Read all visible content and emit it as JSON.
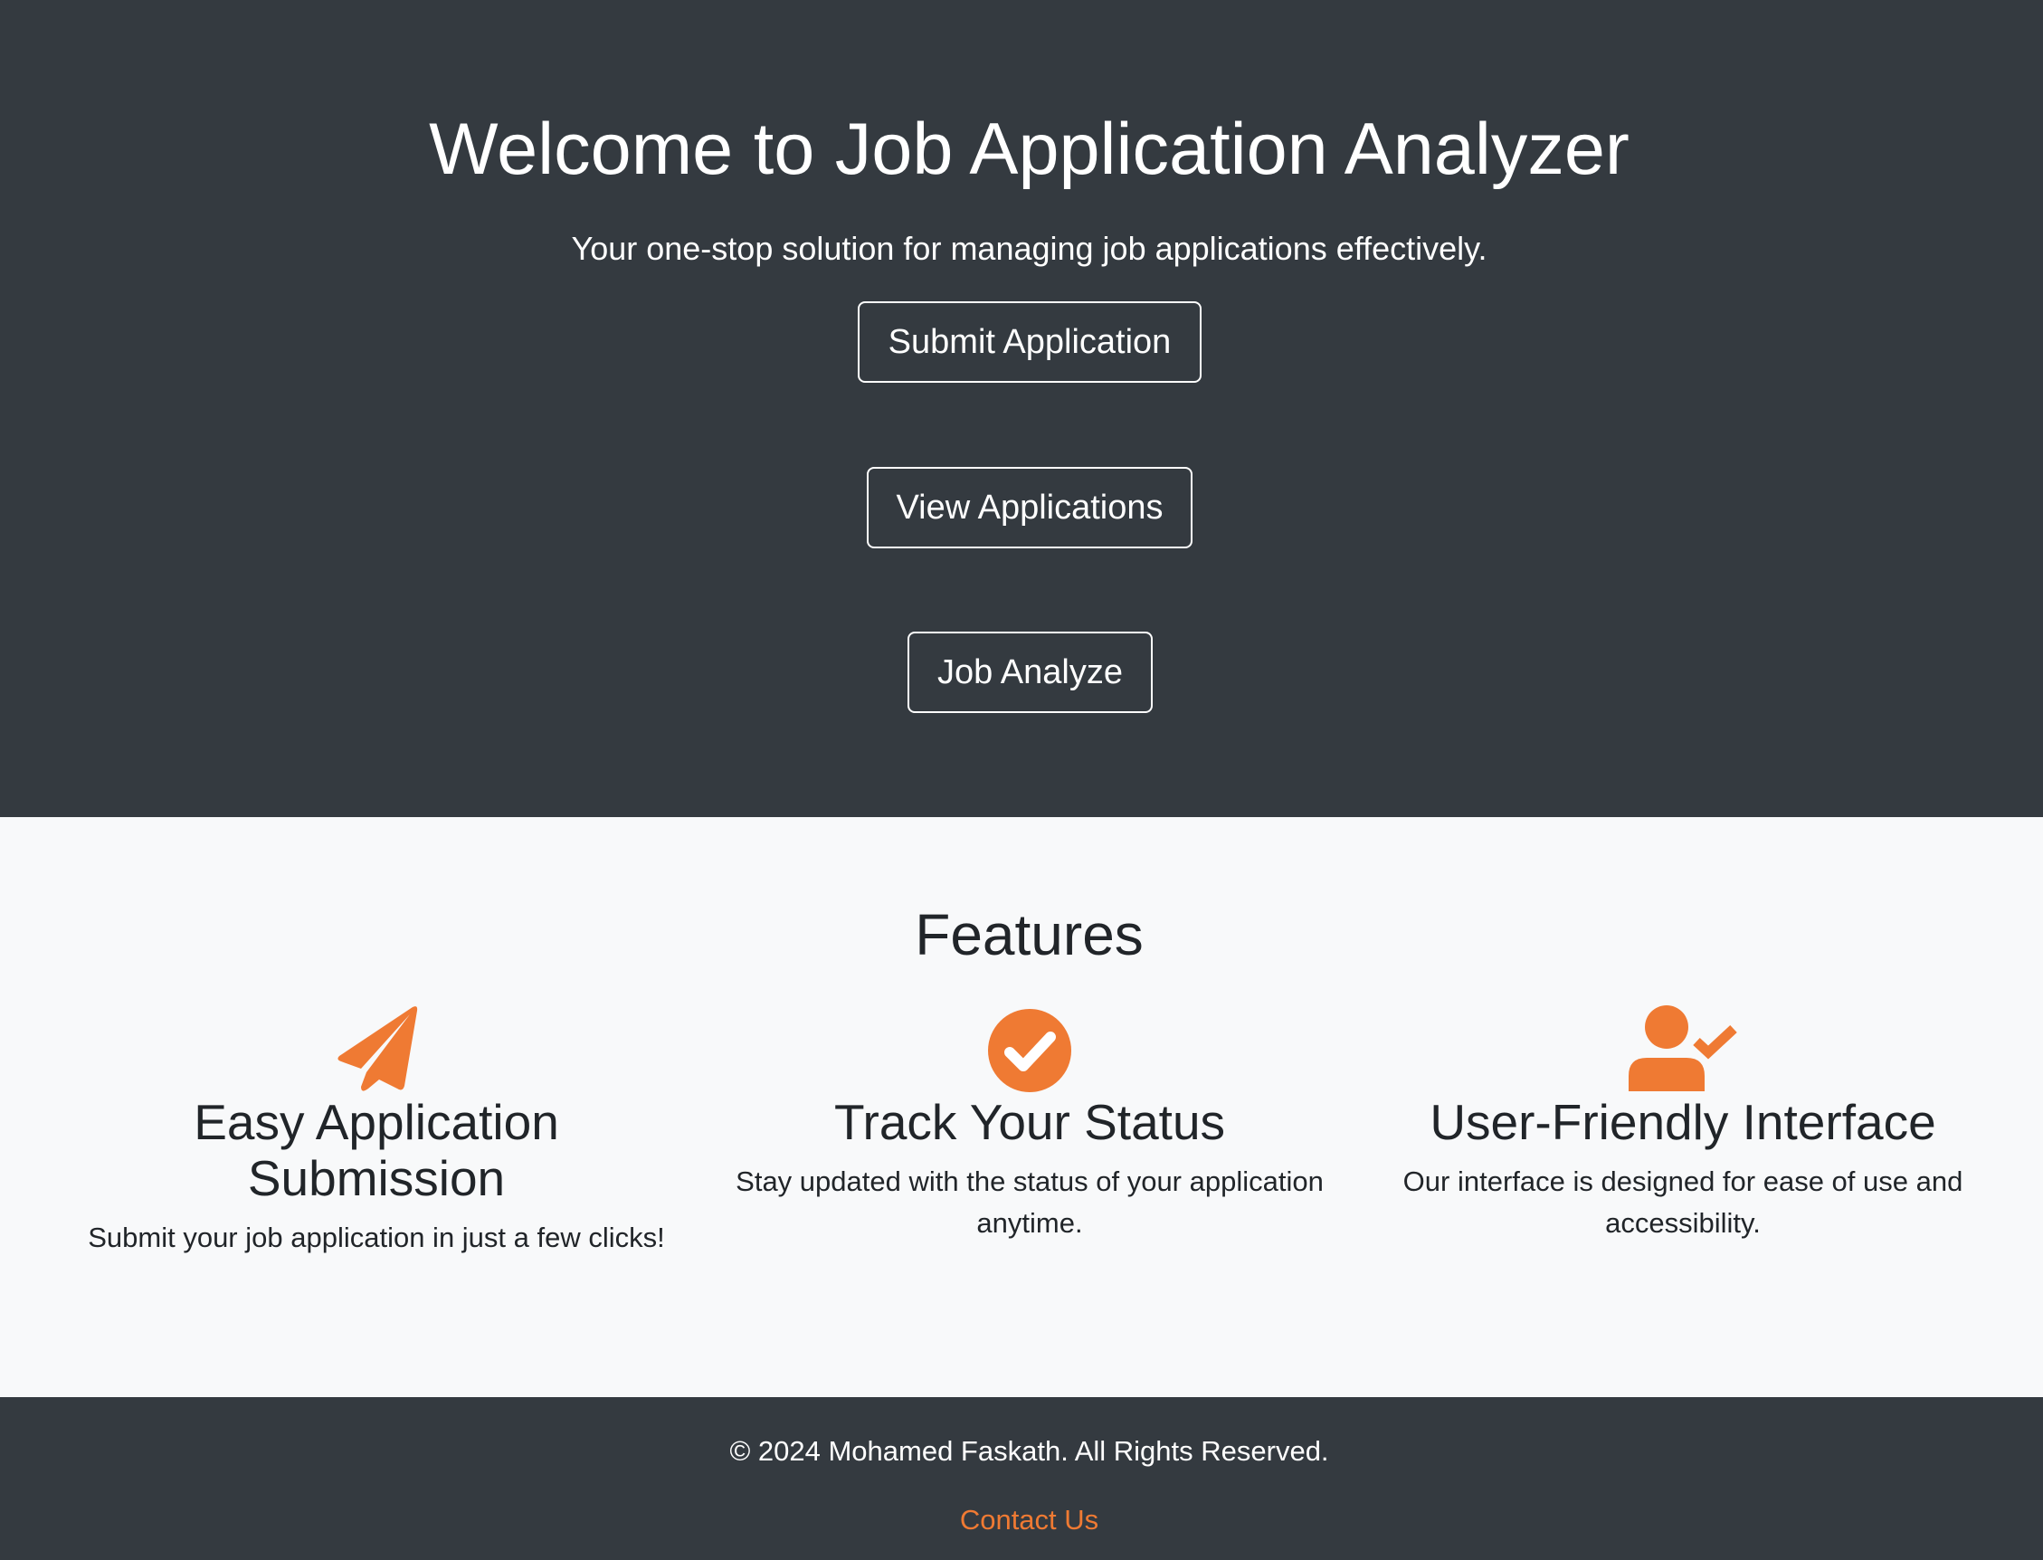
{
  "colors": {
    "dark_bg": "#343a40",
    "light_bg": "#f8f9fa",
    "accent": "#ef7a33",
    "text_light": "#ffffff",
    "text_dark": "#212529"
  },
  "hero": {
    "title": "Welcome to Job Application Analyzer",
    "subtitle": "Your one-stop solution for managing job applications effectively.",
    "buttons": [
      {
        "label": "Submit Application"
      },
      {
        "label": "View Applications"
      },
      {
        "label": "Job Analyze"
      }
    ]
  },
  "features": {
    "title": "Features",
    "items": [
      {
        "icon": "paper-plane-icon",
        "title": "Easy Application Submission",
        "text": "Submit your job application in just a few clicks!"
      },
      {
        "icon": "check-circle-icon",
        "title": "Track Your Status",
        "text": "Stay updated with the status of your application anytime."
      },
      {
        "icon": "user-check-icon",
        "title": "User-Friendly Interface",
        "text": "Our interface is designed for ease of use and accessibility."
      }
    ]
  },
  "footer": {
    "copyright": "© 2024 Mohamed Faskath. All Rights Reserved.",
    "contact_label": "Contact Us"
  }
}
